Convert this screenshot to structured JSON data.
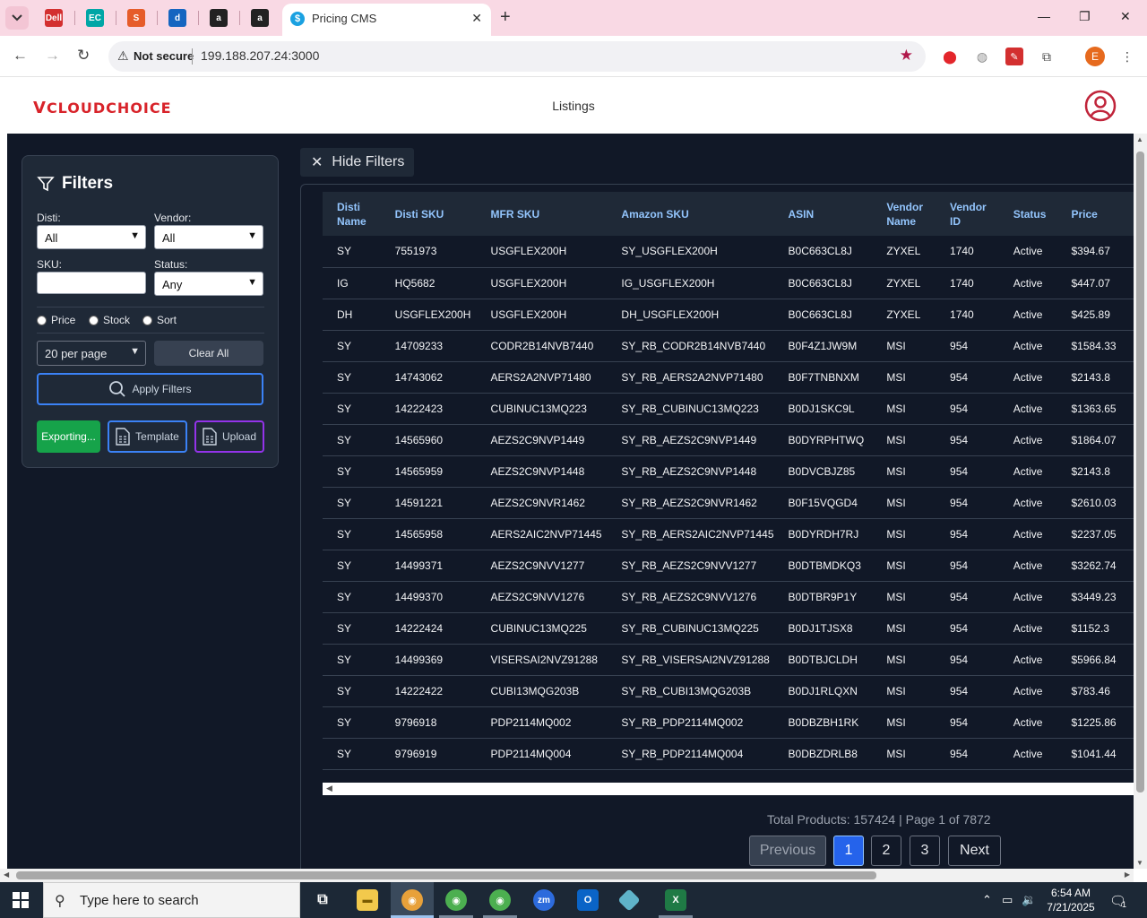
{
  "browser": {
    "active_tab_title": "Pricing CMS",
    "pinned_tabs": [
      {
        "icon": "dell-icon",
        "color": "#d32f2f",
        "glyph": "Dell"
      },
      {
        "icon": "ec-icon",
        "color": "#00a6a6",
        "glyph": "EC"
      },
      {
        "icon": "swirl-icon",
        "color": "#e65c2a",
        "glyph": "S"
      },
      {
        "icon": "blue-app-icon",
        "color": "#1565c0",
        "glyph": "d"
      },
      {
        "icon": "amazon-icon",
        "color": "#222222",
        "glyph": "a"
      },
      {
        "icon": "amazon-icon",
        "color": "#222222",
        "glyph": "a"
      }
    ],
    "security_label": "Not secure",
    "url": "199.188.207.24:3000",
    "profile_initial": "E"
  },
  "app": {
    "logo_text": "CLOUDCHOICE",
    "title": "Listings"
  },
  "filters": {
    "heading": "Filters",
    "disti_label": "Disti:",
    "disti_value": "All",
    "vendor_label": "Vendor:",
    "vendor_value": "All",
    "sku_label": "SKU:",
    "sku_value": "",
    "status_label": "Status:",
    "status_value": "Any",
    "sort_options": [
      "Price",
      "Stock",
      "Sort"
    ],
    "per_page_value": "20 per page",
    "clear_label": "Clear All",
    "apply_label": "Apply Filters",
    "export_label": "Exporting...",
    "template_label": "Template",
    "upload_label": "Upload"
  },
  "hide_filters_label": "Hide Filters",
  "table": {
    "columns": [
      "Disti Name",
      "Disti SKU",
      "MFR SKU",
      "Amazon SKU",
      "ASIN",
      "Vendor Name",
      "Vendor ID",
      "Status",
      "Price"
    ],
    "rows": [
      [
        "SY",
        "7551973",
        "USGFLEX200H",
        "SY_USGFLEX200H",
        "B0C663CL8J",
        "ZYXEL",
        "1740",
        "Active",
        "$394.67"
      ],
      [
        "IG",
        "HQ5682",
        "USGFLEX200H",
        "IG_USGFLEX200H",
        "B0C663CL8J",
        "ZYXEL",
        "1740",
        "Active",
        "$447.07"
      ],
      [
        "DH",
        "USGFLEX200H",
        "USGFLEX200H",
        "DH_USGFLEX200H",
        "B0C663CL8J",
        "ZYXEL",
        "1740",
        "Active",
        "$425.89"
      ],
      [
        "SY",
        "14709233",
        "CODR2B14NVB7440",
        "SY_RB_CODR2B14NVB7440",
        "B0F4Z1JW9M",
        "MSI",
        "954",
        "Active",
        "$1584.33"
      ],
      [
        "SY",
        "14743062",
        "AERS2A2NVP71480",
        "SY_RB_AERS2A2NVP71480",
        "B0F7TNBNXM",
        "MSI",
        "954",
        "Active",
        "$2143.8"
      ],
      [
        "SY",
        "14222423",
        "CUBINUC13MQ223",
        "SY_RB_CUBINUC13MQ223",
        "B0DJ1SKC9L",
        "MSI",
        "954",
        "Active",
        "$1363.65"
      ],
      [
        "SY",
        "14565960",
        "AEZS2C9NVP1449",
        "SY_RB_AEZS2C9NVP1449",
        "B0DYRPHTWQ",
        "MSI",
        "954",
        "Active",
        "$1864.07"
      ],
      [
        "SY",
        "14565959",
        "AEZS2C9NVP1448",
        "SY_RB_AEZS2C9NVP1448",
        "B0DVCBJZ85",
        "MSI",
        "954",
        "Active",
        "$2143.8"
      ],
      [
        "SY",
        "14591221",
        "AEZS2C9NVR1462",
        "SY_RB_AEZS2C9NVR1462",
        "B0F15VQGD4",
        "MSI",
        "954",
        "Active",
        "$2610.03"
      ],
      [
        "SY",
        "14565958",
        "AERS2AIC2NVP71445",
        "SY_RB_AERS2AIC2NVP71445",
        "B0DYRDH7RJ",
        "MSI",
        "954",
        "Active",
        "$2237.05"
      ],
      [
        "SY",
        "14499371",
        "AEZS2C9NVV1277",
        "SY_RB_AEZS2C9NVV1277",
        "B0DTBMDKQ3",
        "MSI",
        "954",
        "Active",
        "$3262.74"
      ],
      [
        "SY",
        "14499370",
        "AEZS2C9NVV1276",
        "SY_RB_AEZS2C9NVV1276",
        "B0DTBR9P1Y",
        "MSI",
        "954",
        "Active",
        "$3449.23"
      ],
      [
        "SY",
        "14222424",
        "CUBINUC13MQ225",
        "SY_RB_CUBINUC13MQ225",
        "B0DJ1TJSX8",
        "MSI",
        "954",
        "Active",
        "$1152.3"
      ],
      [
        "SY",
        "14499369",
        "VISERSAI2NVZ91288",
        "SY_RB_VISERSAI2NVZ91288",
        "B0DTBJCLDH",
        "MSI",
        "954",
        "Active",
        "$5966.84"
      ],
      [
        "SY",
        "14222422",
        "CUBI13MQG203B",
        "SY_RB_CUBI13MQG203B",
        "B0DJ1RLQXN",
        "MSI",
        "954",
        "Active",
        "$783.46"
      ],
      [
        "SY",
        "9796918",
        "PDP2114MQ002",
        "SY_RB_PDP2114MQ002",
        "B0DBZBH1RK",
        "MSI",
        "954",
        "Active",
        "$1225.86"
      ],
      [
        "SY",
        "9796919",
        "PDP2114MQ004",
        "SY_RB_PDP2114MQ004",
        "B0DBZDRLB8",
        "MSI",
        "954",
        "Active",
        "$1041.44"
      ]
    ]
  },
  "pagination": {
    "summary": "Total Products: 157424 | Page 1 of 7872",
    "previous_label": "Previous",
    "pages": [
      "1",
      "2",
      "3"
    ],
    "next_label": "Next"
  },
  "taskbar": {
    "search_placeholder": "Type here to search",
    "time": "6:54 AM",
    "date": "7/21/2025",
    "notification_count": "1"
  },
  "colors": {
    "app_bg": "#111827",
    "panel_bg": "#1f2937",
    "accent_blue": "#2563eb",
    "export_green": "#16a34a",
    "upload_purple": "#9333ea",
    "logo_red": "#d8232a"
  }
}
